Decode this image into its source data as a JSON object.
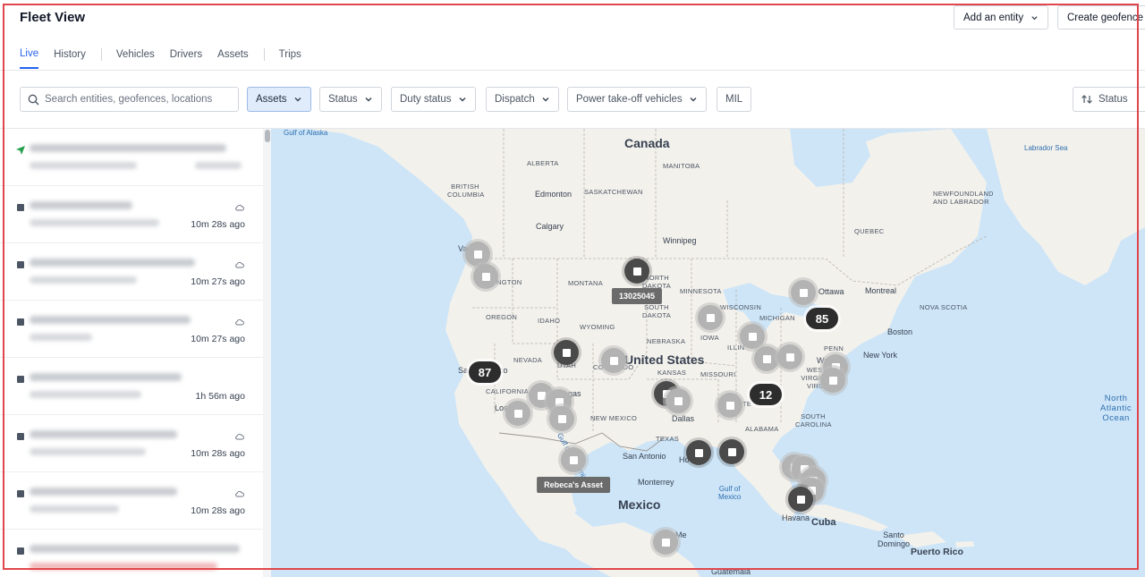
{
  "header": {
    "title": "Fleet View",
    "add_entity": "Add an entity",
    "create_geofence": "Create geofence"
  },
  "tabs": [
    "Live",
    "History",
    "Vehicles",
    "Drivers",
    "Assets",
    "Trips"
  ],
  "search": {
    "placeholder": "Search entities, geofences, locations"
  },
  "filters": [
    "Assets",
    "Status",
    "Duty status",
    "Dispatch",
    "Power take-off vehicles",
    "MIL"
  ],
  "sort": {
    "label": "Status"
  },
  "list_items": [
    {
      "time": ""
    },
    {
      "time": "10m 28s ago"
    },
    {
      "time": "10m 27s ago"
    },
    {
      "time": "10m 27s ago"
    },
    {
      "time": "1h 56m ago"
    },
    {
      "time": "10m 28s ago"
    },
    {
      "time": "10m 28s ago"
    },
    {
      "time": ""
    }
  ],
  "map": {
    "countries": {
      "canada": "Canada",
      "us": "United States",
      "mexico": "Mexico",
      "cuba": "Cuba",
      "puerto_rico": "Puerto Rico",
      "guatemala": "Guatemala"
    },
    "regions": {
      "alberta": "ALBERTA",
      "manitoba": "MANITOBA",
      "british_columbia": "BRITISH COLUMBIA",
      "saskatchewan": "SASKATCHEWAN",
      "quebec": "QUEBEC",
      "newfoundland": "NEWFOUNDLAND AND LABRADOR",
      "montana": "MONTANA",
      "north_dakota": "NORTH DAKOTA",
      "south_dakota": "SOUTH DAKOTA",
      "minnesota": "MINNESOTA",
      "wisconsin": "WISCONSIN",
      "michigan": "MICHIGAN",
      "oregon": "OREGON",
      "idaho": "IDAHO",
      "wyoming": "WYOMING",
      "nebraska": "NEBRASKA",
      "iowa": "IOWA",
      "illinois": "ILLIN",
      "nevada": "NEVADA",
      "utah": "UTAH",
      "colorado": "COLORADO",
      "kansas": "KANSAS",
      "missouri": "MISSOURI",
      "california": "CALIFORNIA",
      "new_mexico": "NEW MEXICO",
      "texas": "TEXAS",
      "alabama": "ALABAMA",
      "tennessee": "TE",
      "penn": "PENN",
      "west_virginia": "WEST\nVIRGINIA",
      "virginia": "VIRG",
      "south_carolina": "SOUTH\nCAROLINA",
      "nova_scotia": "NOVA SCOTIA",
      "washington_state": "NGTON"
    },
    "cities": {
      "edmonton": "Edmonton",
      "calgary": "Calgary",
      "winnipeg": "Winnipeg",
      "ottawa": "Ottawa",
      "montreal": "Montreal",
      "boston": "Boston",
      "new_york": "New York",
      "washington": "Wa",
      "dallas": "Dallas",
      "houston": "Ho",
      "san_antonio": "San Antonio",
      "monterrey": "Monterrey",
      "havana": "Havana",
      "santo_domingo": "Santo\nDomingo",
      "mexico_city": "Me",
      "los_angeles": "Los",
      "las_vegas": "gas",
      "san_francisco": "Sa",
      "sf_tail": "co",
      "vancouver": "Va"
    },
    "waters": {
      "gulf_alaska": "Gulf of Alaska",
      "labrador_sea": "Labrador Sea",
      "gulf_mexico": "Gulf of\nMexico",
      "north_atlantic": "North\nAtlantic\nOcean",
      "gulf_california": "Gulf of California"
    },
    "clusters": [
      "87",
      "85",
      "12"
    ],
    "tooltips": {
      "vehicle": "13025045",
      "asset": "Rebeca's Asset"
    }
  }
}
